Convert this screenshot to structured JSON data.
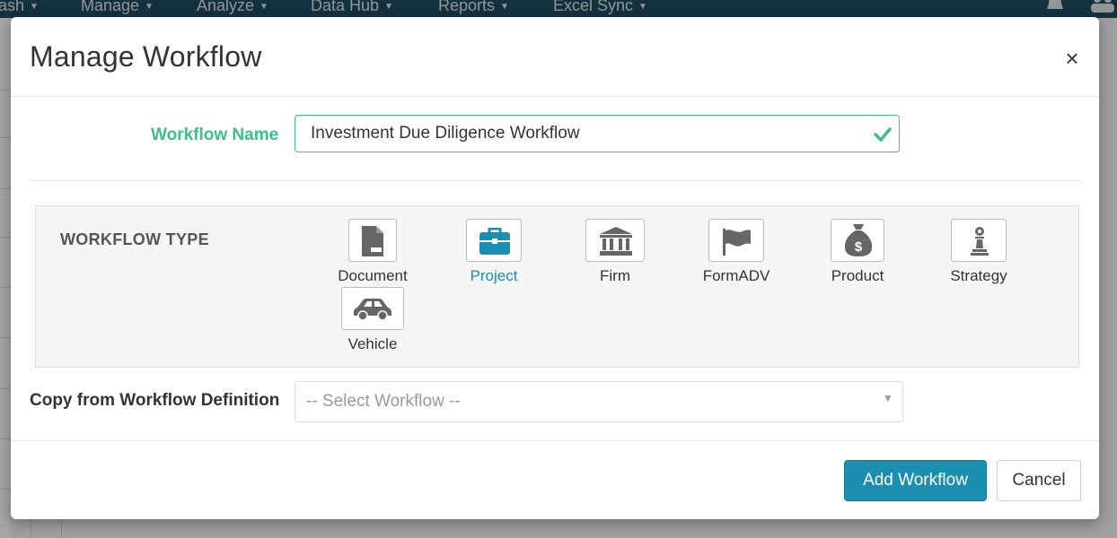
{
  "background": {
    "nav": [
      {
        "label": "ash"
      },
      {
        "label": "Manage"
      },
      {
        "label": "Analyze"
      },
      {
        "label": "Data Hub"
      },
      {
        "label": "Reports"
      },
      {
        "label": "Excel Sync"
      }
    ],
    "icons": [
      "bell-icon",
      "users-icon"
    ]
  },
  "modal": {
    "title": "Manage Workflow",
    "close_label": "×",
    "workflow_name": {
      "label": "Workflow Name",
      "value": "Investment Due Diligence Workflow",
      "valid": true
    },
    "workflow_type": {
      "label": "WORKFLOW TYPE",
      "selected": "Project",
      "options": [
        {
          "label": "Document",
          "icon": "document-icon"
        },
        {
          "label": "Project",
          "icon": "briefcase-icon"
        },
        {
          "label": "Firm",
          "icon": "bank-icon"
        },
        {
          "label": "FormADV",
          "icon": "flag-icon"
        },
        {
          "label": "Product",
          "icon": "money-bag-icon"
        },
        {
          "label": "Strategy",
          "icon": "chess-pawn-icon"
        },
        {
          "label": "Vehicle",
          "icon": "car-icon"
        }
      ]
    },
    "copy_from": {
      "label": "Copy from Workflow Definition",
      "placeholder": "-- Select Workflow --",
      "arrow": "▼"
    },
    "buttons": {
      "add": "Add Workflow",
      "cancel": "Cancel"
    }
  },
  "colors": {
    "accent": "#1a8fb0",
    "valid": "#3cbf8c",
    "nav_bg": "#1f4d5e"
  }
}
